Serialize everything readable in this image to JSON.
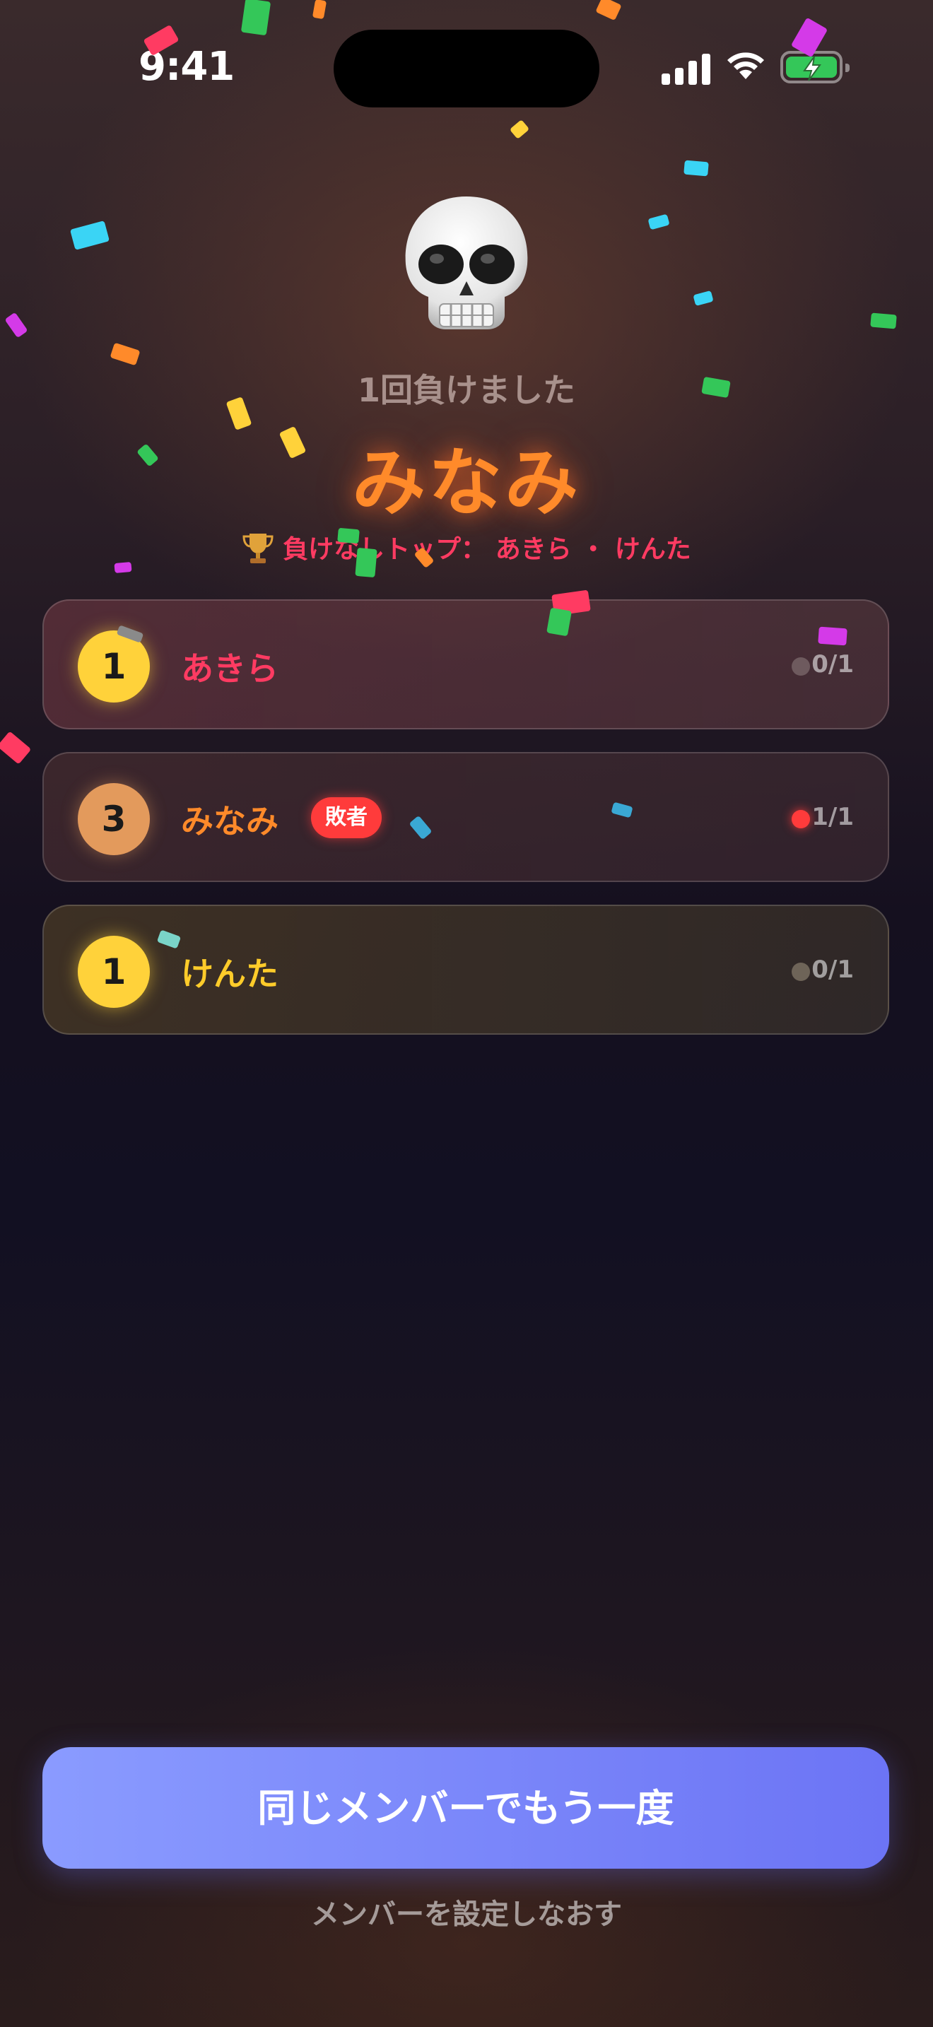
{
  "status_bar": {
    "time": "9:41"
  },
  "result": {
    "subtitle": "1回負けました",
    "loser_name": "みなみ",
    "top_label": "負けなしトップ：",
    "top_names": "あきら ・ けんた"
  },
  "players": [
    {
      "rank": "1",
      "name": "あきら",
      "badge": "",
      "score": "0/1",
      "rank_color": "#ffd23a",
      "name_color": "#ff3b62",
      "dot_color": "#6e5a5e"
    },
    {
      "rank": "3",
      "name": "みなみ",
      "badge": "敗者",
      "score": "1/1",
      "rank_color": "#e39a5c",
      "name_color": "#ff8a2a",
      "dot_color": "#ff3b3b"
    },
    {
      "rank": "1",
      "name": "けんた",
      "badge": "",
      "score": "0/1",
      "rank_color": "#ffd23a",
      "name_color": "#ffcc2a",
      "dot_color": "#6e6458"
    }
  ],
  "actions": {
    "primary": "同じメンバーでもう一度",
    "secondary": "メンバーを設定しなおす"
  },
  "icons": {
    "skull": "skull-icon",
    "trophy": "trophy-icon",
    "signal": "signal-icon",
    "wifi": "wifi-icon",
    "battery": "battery-charging-icon"
  }
}
